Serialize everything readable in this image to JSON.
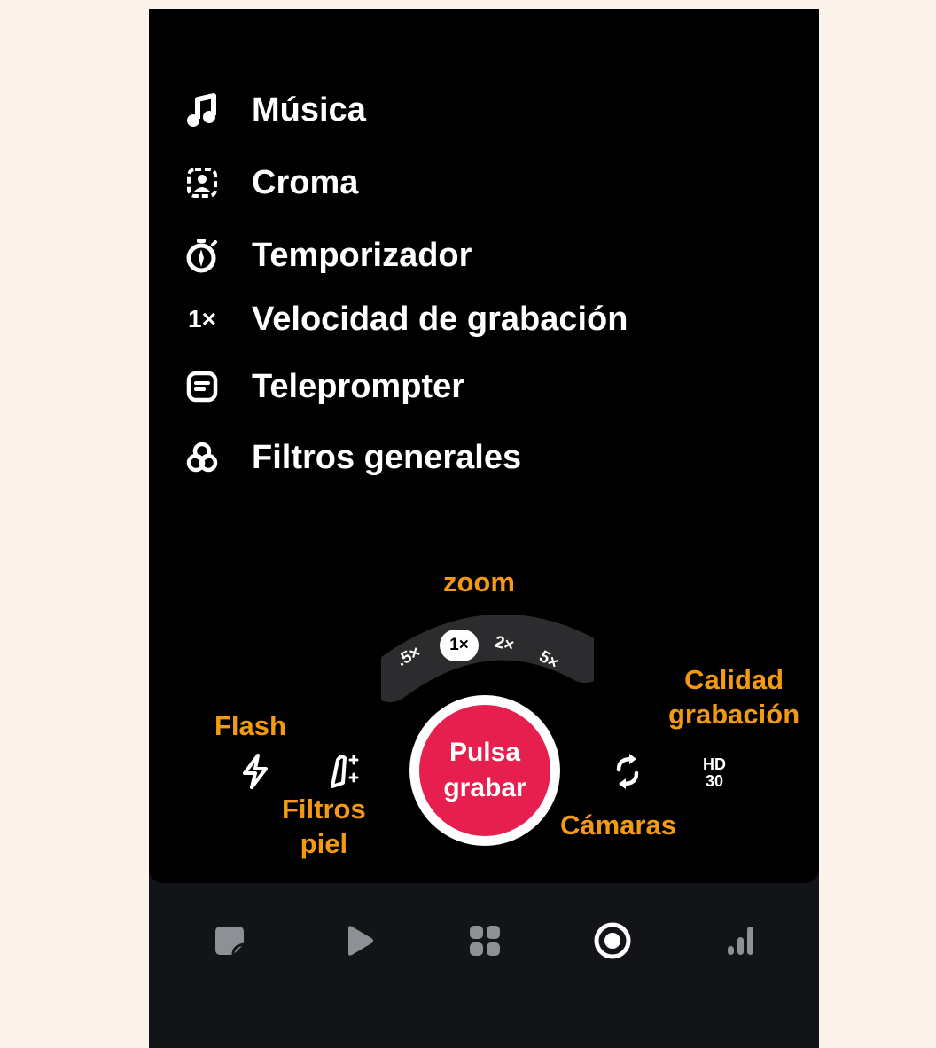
{
  "menu": {
    "items": [
      {
        "label": "Música",
        "icon": "music-note-icon"
      },
      {
        "label": "Croma",
        "icon": "chroma-person-icon"
      },
      {
        "label": "Temporizador",
        "icon": "timer-icon"
      },
      {
        "label": "Velocidad de grabación",
        "icon_text": "1×"
      },
      {
        "label": "Teleprompter",
        "icon": "teleprompter-icon"
      },
      {
        "label": "Filtros generales",
        "icon": "filters-icon"
      }
    ]
  },
  "callouts": {
    "zoom": "zoom",
    "flash": "Flash",
    "skin_line1": "Filtros",
    "skin_line2": "piel",
    "cameras": "Cámaras",
    "quality_line1": "Calidad",
    "quality_line2": "grabación"
  },
  "zoom": {
    "options": [
      ".5×",
      "1×",
      "2×",
      "5×"
    ],
    "selected": "1×"
  },
  "record": {
    "line1": "Pulsa",
    "line2": "grabar"
  },
  "quality": {
    "line1": "HD",
    "line2": "30"
  },
  "colors": {
    "accent_orange": "#f39a14",
    "record_red": "#e61f4f",
    "background": "#fcf4ea"
  },
  "nav": {
    "items": [
      "posts-icon",
      "play-icon",
      "apps-grid-icon",
      "record-icon",
      "stats-icon"
    ],
    "active": "record-icon"
  }
}
